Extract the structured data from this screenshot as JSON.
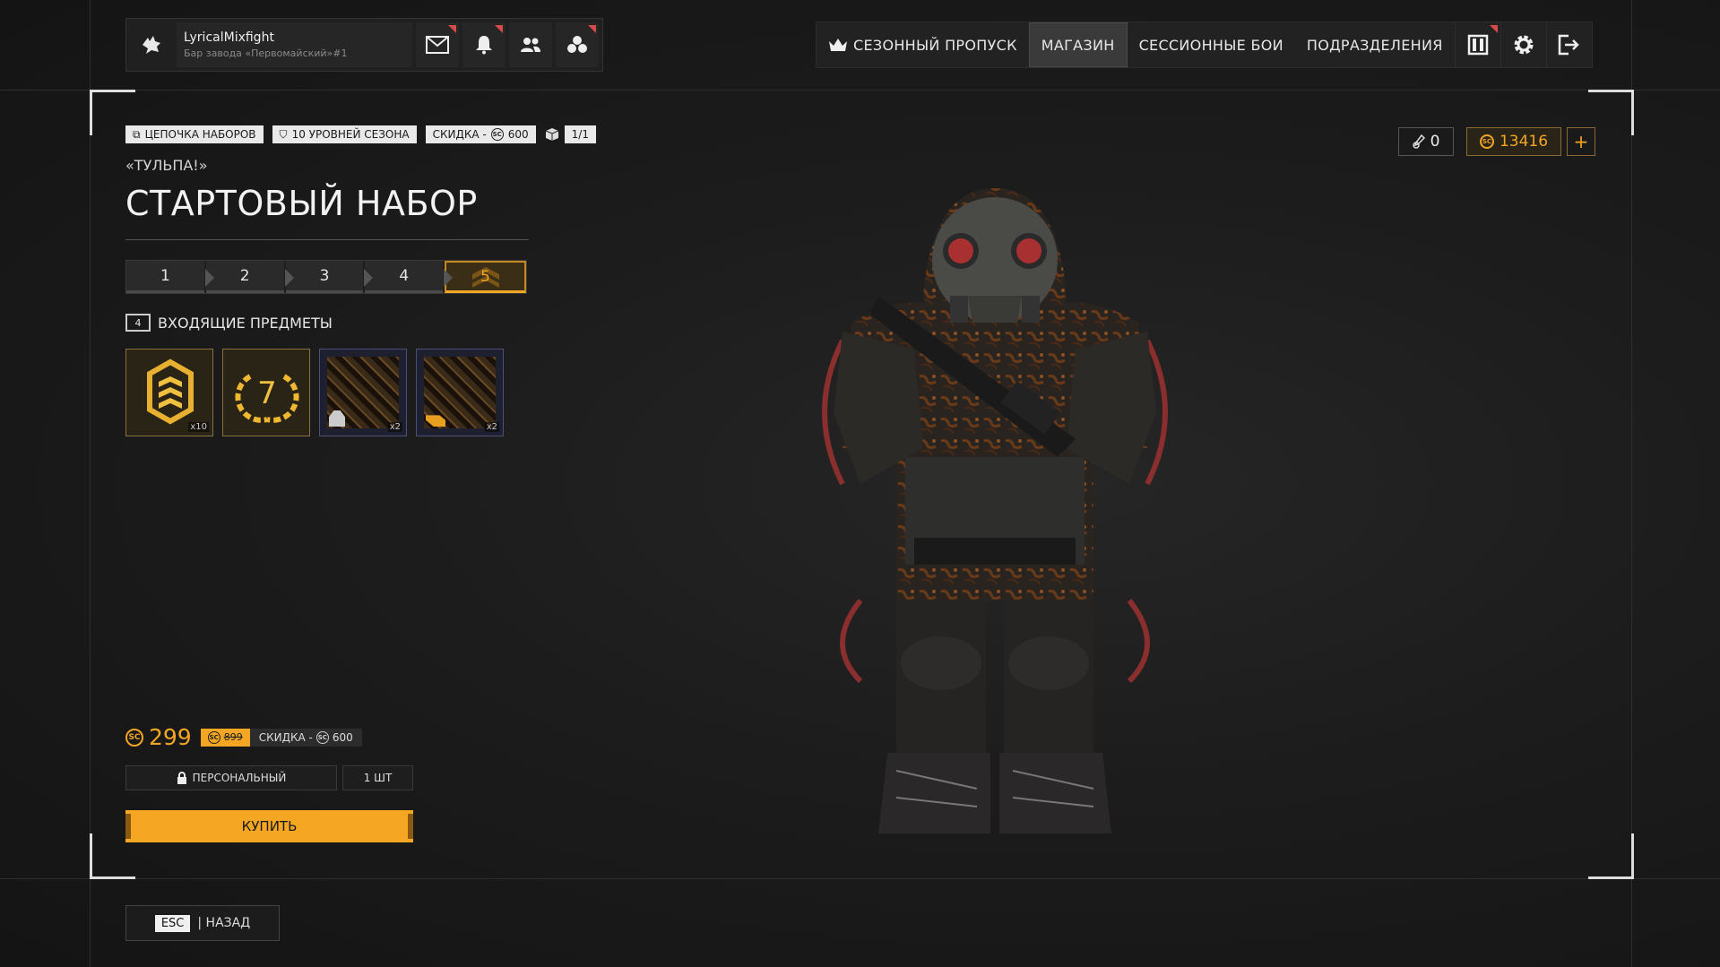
{
  "profile": {
    "nickname": "LyricalMixfight",
    "club": "Бар завода «Первомайский»#1"
  },
  "nav": {
    "items": [
      "СЕЗОННЫЙ ПРОПУСК",
      "МАГАЗИН",
      "СЕССИОННЫЕ БОИ",
      "ПОДРАЗДЕЛЕНИЯ"
    ],
    "active": "МАГАЗИН"
  },
  "tags": {
    "chain": "ЦЕПОЧКА НАБОРОВ",
    "season_levels": "10 УРОВНЕЙ СЕЗОНА",
    "discount_label": "СКИДКА -",
    "discount_value": "600",
    "count": "1/1"
  },
  "bundle": {
    "subtitle": "«ТУЛЬПА!»",
    "title": "СТАРТОВЫЙ НАБОР"
  },
  "steps": [
    "1",
    "2",
    "3",
    "4",
    "5"
  ],
  "included": {
    "count": "4",
    "label": "ВХОДЯЩИЕ ПРЕДМЕТЫ",
    "items": [
      {
        "icon": "rank-chevron-icon",
        "qty": "x10"
      },
      {
        "icon": "laurel-seven-icon",
        "number": "7",
        "qty": ""
      },
      {
        "icon": "camo-skin-armor-icon",
        "qty": "x2"
      },
      {
        "icon": "camo-skin-weapon-icon",
        "qty": "x2"
      }
    ]
  },
  "price": {
    "current": "299",
    "old": "899",
    "discount_label": "СКИДКА -",
    "discount_value": "600"
  },
  "options": {
    "personal": "ПЕРСОНАЛЬНЫЙ",
    "quantity": "1 ШТ"
  },
  "buy_label": "КУПИТЬ",
  "back": {
    "key": "ESC",
    "label": "| НАЗАД"
  },
  "currency": {
    "tokens": "0",
    "coins": "13416",
    "plus": "+",
    "coin_symbol": "SC"
  },
  "colors": {
    "accent": "#f5a623",
    "background": "#1a1a1a",
    "notification": "#d84a4a"
  }
}
